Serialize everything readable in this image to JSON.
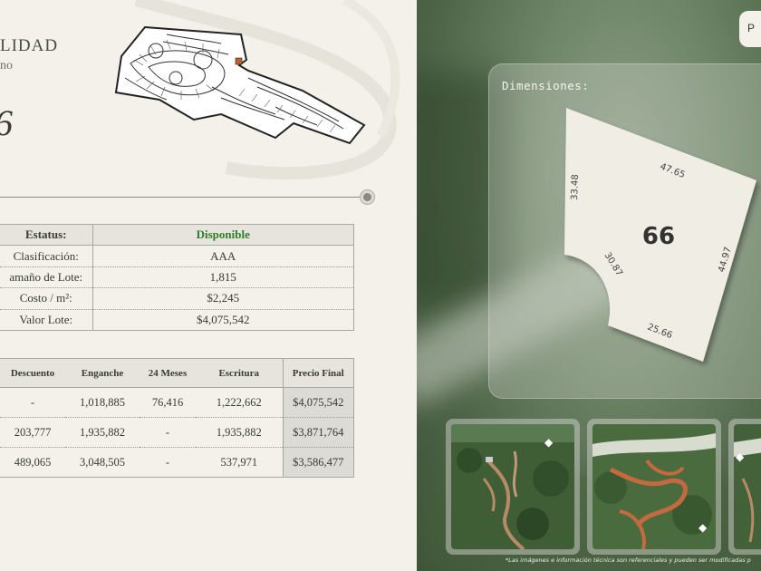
{
  "header": {
    "title": "LIDAD",
    "subtitle": "no",
    "lot_number_partial": "6"
  },
  "lot_info": {
    "rows": [
      {
        "label": "Estatus:",
        "value": "Disponible"
      },
      {
        "label": "Clasificación:",
        "value": "AAA"
      },
      {
        "label": "amaño de Lote:",
        "value": "1,815"
      },
      {
        "label": "Costo / m²:",
        "value": "$2,245"
      },
      {
        "label": "Valor Lote:",
        "value": "$4,075,542"
      }
    ]
  },
  "pricing": {
    "headers": [
      "Descuento",
      "Enganche",
      "24 Meses",
      "Escritura",
      "Precio Final"
    ],
    "rows": [
      [
        "-",
        "1,018,885",
        "76,416",
        "1,222,662",
        "$4,075,542"
      ],
      [
        "203,777",
        "1,935,882",
        "-",
        "1,935,882",
        "$3,871,764"
      ],
      [
        "489,065",
        "3,048,505",
        "-",
        "537,971",
        "$3,586,477"
      ]
    ]
  },
  "fullscreen_button": {
    "label": "P"
  },
  "dimensions": {
    "label": "Dimensiones:",
    "lot_number": "66",
    "sides": [
      "47.65",
      "33.48",
      "30.87",
      "44.97",
      "25.66"
    ]
  },
  "gallery": {
    "disclaimer": "*Las imágenes e información técnica son referenciales y pueden ser modificadas p"
  },
  "colors": {
    "status_available": "#2e7d2a",
    "panel_bg": "#f3f1ea",
    "lot_fill": "#efede4"
  },
  "icons": [
    "view-360-icon",
    "view-360-icon",
    "view-360-icon",
    "view-360-icon"
  ]
}
